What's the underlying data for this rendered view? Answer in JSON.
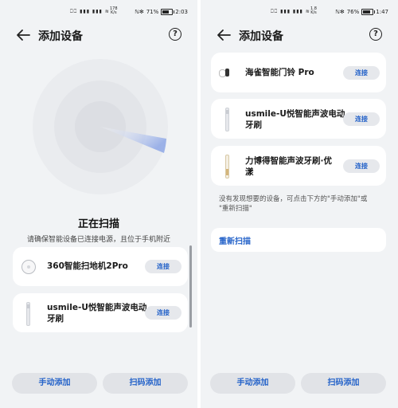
{
  "left": {
    "status": {
      "icons": "⎕⎕ ▮▮▮ ▮▮▮ ≋",
      "speed_top": "178",
      "speed_bottom": "K/s",
      "battery_pct": "71%",
      "time": "2:03"
    },
    "header": {
      "title": "添加设备"
    },
    "scan": {
      "title": "正在扫描",
      "subtitle": "请确保智能设备已连接电源，且位于手机附近"
    },
    "devices": [
      {
        "name": "360智能扫地机2Pro",
        "icon": "robot-vacuum-icon",
        "connect_label": "连接"
      },
      {
        "name_line1": "usmile-U悦智能声波电动",
        "name_line2": "牙刷",
        "icon": "toothbrush-icon",
        "connect_label": "连接"
      }
    ],
    "buttons": {
      "manual": "手动添加",
      "scan_code": "扫码添加"
    }
  },
  "right": {
    "status": {
      "icons": "⎕⎕ ▮▮▮ ▮▮▮ ≋",
      "speed_top": "1.8",
      "speed_bottom": "K/s",
      "battery_pct": "76%",
      "time": "1:47"
    },
    "header": {
      "title": "添加设备"
    },
    "devices": [
      {
        "name": "海雀智能门铃 Pro",
        "icon": "doorbell-icon",
        "connect_label": "连接"
      },
      {
        "name_line1": "usmile-U悦智能声波电动",
        "name_line2": "牙刷",
        "icon": "toothbrush-icon",
        "connect_label": "连接"
      },
      {
        "name_line1": "力博得智能声波牙刷·优",
        "name_line2": "漾",
        "icon": "toothbrush-gold-icon",
        "connect_label": "连接"
      }
    ],
    "hint_line1": "没有发现想要的设备，可点击下方的\"手动添加\"或",
    "hint_line2": "\"重新扫描\"",
    "rescan_label": "重新扫描",
    "buttons": {
      "manual": "手动添加",
      "scan_code": "扫码添加"
    }
  },
  "colors": {
    "accent": "#2563c9",
    "background": "#f1f3f5",
    "card": "#ffffff",
    "radar": "#e3e5e9",
    "radar_beam": "#9fb3e6"
  }
}
